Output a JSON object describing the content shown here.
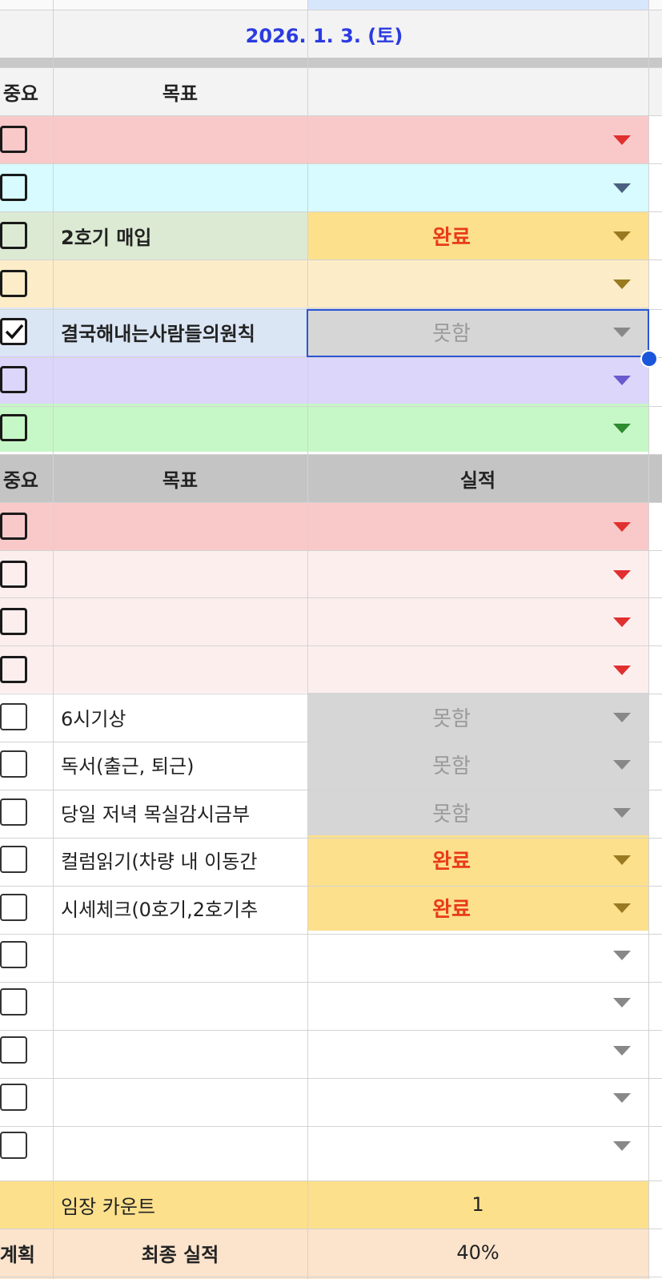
{
  "sheet": {
    "date_label": "2026. 1. 3. (토)",
    "header1": {
      "col_importance": "중요",
      "col_goal": "목표",
      "col_result": ""
    },
    "header2": {
      "col_importance": "중요",
      "col_goal": "목표",
      "col_result": "실적"
    },
    "top_rows": [
      {
        "checked": false,
        "goal": "",
        "result": "",
        "arrow_color": "#e03030"
      },
      {
        "checked": false,
        "goal": "",
        "result": "",
        "arrow_color": "#4a6080"
      },
      {
        "checked": false,
        "goal": "2호기 매입",
        "result": "완료",
        "arrow_color": "#9a7a20"
      },
      {
        "checked": false,
        "goal": "",
        "result": "",
        "arrow_color": "#9a7a20"
      },
      {
        "checked": true,
        "goal": "결국해내는사람들의원칙",
        "result": "못함",
        "arrow_color": "#888888"
      },
      {
        "checked": false,
        "goal": "",
        "result": "",
        "arrow_color": "#6a5acd"
      },
      {
        "checked": false,
        "goal": "",
        "result": "",
        "arrow_color": "#2e8b2e"
      }
    ],
    "bottom_rows": [
      {
        "checked": false,
        "goal": "",
        "result": "",
        "arrow_color": "#e03030"
      },
      {
        "checked": false,
        "goal": "",
        "result": "",
        "arrow_color": "#e03030"
      },
      {
        "checked": false,
        "goal": "",
        "result": "",
        "arrow_color": "#e03030"
      },
      {
        "checked": false,
        "goal": "",
        "result": "",
        "arrow_color": "#e03030"
      },
      {
        "checked": false,
        "goal": "6시기상",
        "result": "못함",
        "arrow_color": "#888888"
      },
      {
        "checked": false,
        "goal": "독서(출근, 퇴근)",
        "result": "못함",
        "arrow_color": "#888888"
      },
      {
        "checked": false,
        "goal": "당일 저녁 목실감시금부",
        "result": "못함",
        "arrow_color": "#888888"
      },
      {
        "checked": false,
        "goal": "컬럼읽기(차량 내 이동간",
        "result": "완료",
        "arrow_color": "#9a7a20"
      },
      {
        "checked": false,
        "goal": "시세체크(0호기,2호기추",
        "result": "완료",
        "arrow_color": "#9a7a20"
      },
      {
        "checked": false,
        "goal": "",
        "result": "",
        "arrow_color": "#888888"
      },
      {
        "checked": false,
        "goal": "",
        "result": "",
        "arrow_color": "#888888"
      },
      {
        "checked": false,
        "goal": "",
        "result": "",
        "arrow_color": "#888888"
      },
      {
        "checked": false,
        "goal": "",
        "result": "",
        "arrow_color": "#888888"
      },
      {
        "checked": false,
        "goal": "",
        "result": "",
        "arrow_color": "#888888"
      }
    ],
    "summary": {
      "count_label": "임장 카운트",
      "count_value": "1",
      "plan_label": "계획",
      "final_label": "최종 실적",
      "final_value": "40%"
    },
    "colors": {
      "date_text": "#2b3be0",
      "done_text": "#e83a1c",
      "notdone_text": "#9a9a9a",
      "done_bg": "#fde08c",
      "notdone_bg": "#d6d6d6",
      "selection": "#2b55d6"
    }
  }
}
